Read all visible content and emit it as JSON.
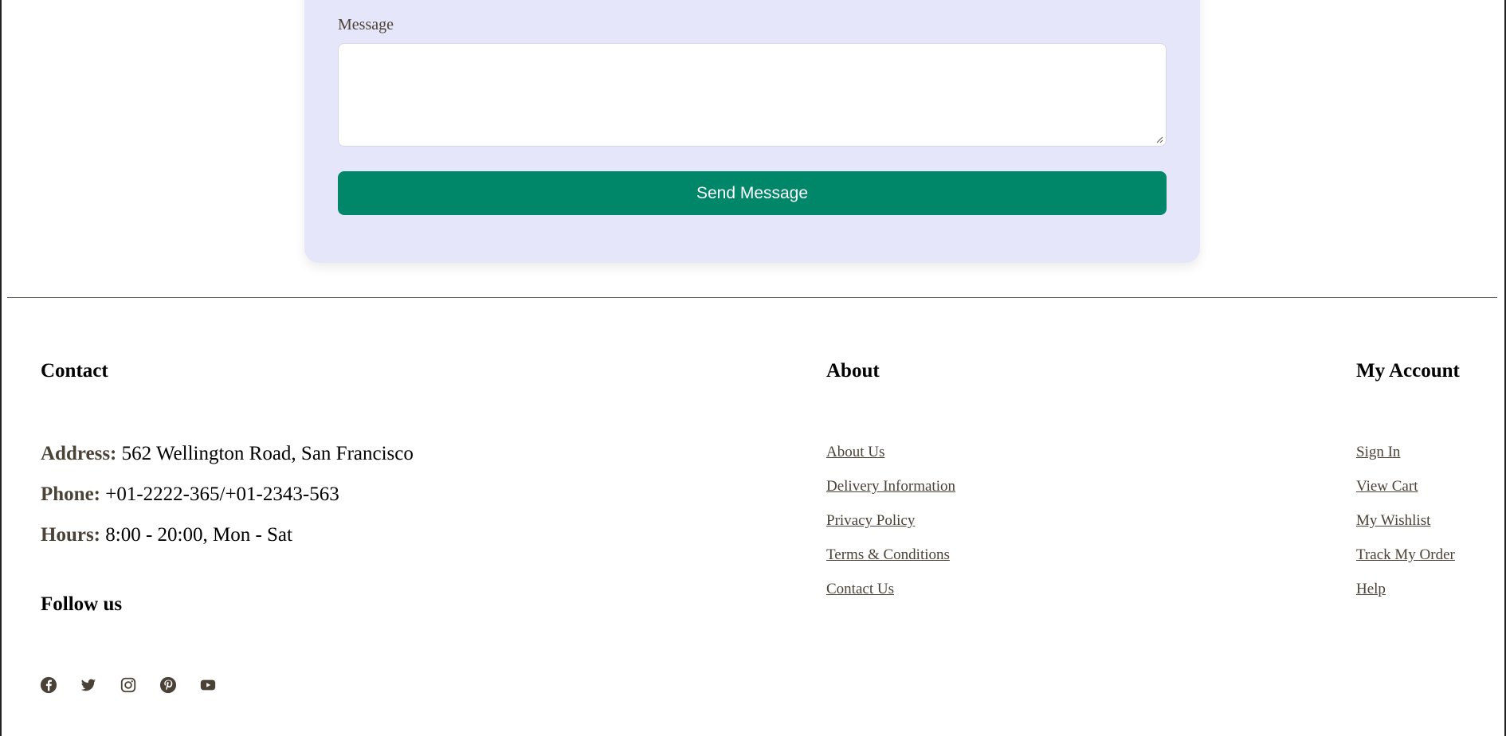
{
  "form": {
    "message_label": "Message",
    "message_value": "",
    "send_button_label": "Send Message"
  },
  "footer": {
    "contact": {
      "heading": "Contact",
      "address_key": "Address:",
      "address_value": " 562 Wellington Road, San Francisco",
      "phone_key": "Phone:",
      "phone_value": " +01-2222-365/+01-2343-563",
      "hours_key": "Hours:",
      "hours_value": " 8:00 - 20:00, Mon - Sat"
    },
    "follow": {
      "heading": "Follow us",
      "icons": [
        "facebook-icon",
        "twitter-icon",
        "instagram-icon",
        "pinterest-icon",
        "youtube-icon"
      ]
    },
    "about": {
      "heading": "About",
      "links": [
        "About Us",
        "Delivery Information",
        "Privacy Policy",
        "Terms & Conditions",
        "Contact Us"
      ]
    },
    "account": {
      "heading": "My Account",
      "links": [
        "Sign In",
        "View Cart",
        "My Wishlist",
        "Track My Order",
        "Help"
      ]
    }
  },
  "colors": {
    "card_background": "#e6e6fa",
    "button_green": "#008668",
    "text_brown": "#4b4237"
  }
}
